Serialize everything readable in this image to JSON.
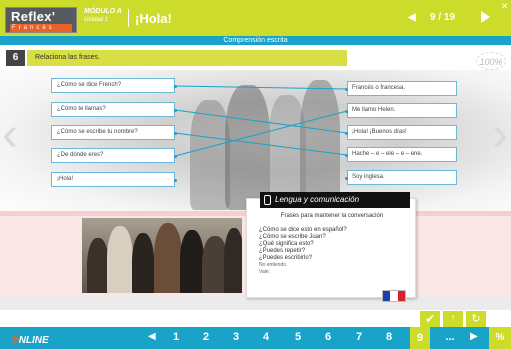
{
  "header": {
    "logo_main": "Reflex'",
    "logo_sub": "Francés",
    "modulo": "MÓDULO A",
    "unidad": "Unidad 1",
    "title": "¡Hola!",
    "page_indicator": "9 / 19",
    "subtitle": "Comprensión escrita"
  },
  "exercise": {
    "number": "6",
    "instruction": "Relaciona las frases.",
    "badge": "100%",
    "left_items": [
      "¿Cómo se dice French?",
      "¿Cómo te llamas?",
      "¿Cómo se escribe tu nombre?",
      "¿De dónde eres?",
      "¡Hola!"
    ],
    "right_items": [
      "Francés o francesa.",
      "Me llamo Helen.",
      "¡Hola! ¡Buenos días!",
      "Hache – e – ele – e – ene.",
      "Soy inglesa."
    ]
  },
  "card": {
    "heading": "Lengua y comunicación",
    "subheading": "Frases para mantener la conversación",
    "lines": [
      "¿Cómo se dice esto en español?",
      "¿Cómo se escribe Juan?",
      "¿Qué significa esto?",
      "¿Puedes repetir?",
      "¿Puedes escribirlo?"
    ],
    "small_lines": [
      "No entiendo.",
      "Vale."
    ]
  },
  "colors": {
    "lime": "#cddc2b",
    "blue": "#19a3c9",
    "pink": "#fbe6e6"
  },
  "footer": {
    "brand": "NLINE",
    "brand_mark": "6",
    "pages": [
      "1",
      "2",
      "3",
      "4",
      "5",
      "6",
      "7",
      "8",
      "9",
      "..."
    ],
    "active_page": "9",
    "percent": "%"
  }
}
